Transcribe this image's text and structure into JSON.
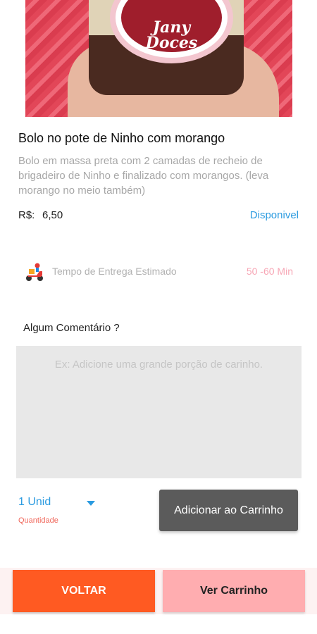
{
  "product": {
    "image_logo_line1": "Jany",
    "image_logo_line2": "Doces",
    "name": "Bolo no pote de Ninho com morango",
    "description": "Bolo em massa preta com 2 camadas de recheio de brigadeiro de Ninho e finalizado com morangos. (leva morango no meio também)",
    "price_label": "R$:",
    "price_value": "6,50",
    "availability": "Disponivel"
  },
  "delivery": {
    "icon": "delivery-scooter-icon",
    "label": "Tempo de Entrega Estimado",
    "time": "50 -60 Min"
  },
  "comment": {
    "label": "Algum Comentário ?",
    "placeholder": "Ex: Adicione uma grande porção de carinho."
  },
  "quantity": {
    "value": "1 Unid",
    "caption": "Quantidade"
  },
  "actions": {
    "add_to_cart": "Adicionar ao Carrinho",
    "back": "VOLTAR",
    "view_cart": "Ver Carrinho"
  },
  "colors": {
    "accent_blue": "#2b9be0",
    "back_button": "#ff5a22",
    "cart_button": "#ffadb0",
    "add_button": "#5b5b5b"
  }
}
